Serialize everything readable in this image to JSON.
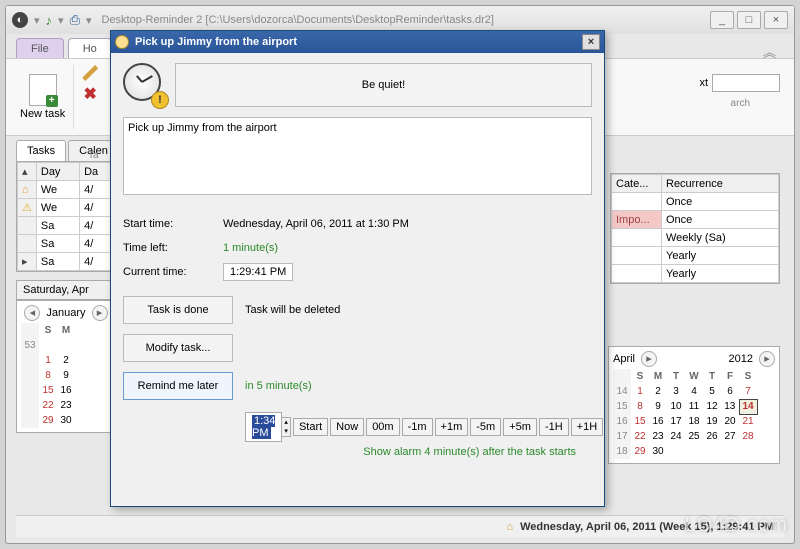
{
  "window": {
    "title": "Desktop-Reminder 2 [C:\\Users\\dozorca\\Documents\\DesktopReminder\\tasks.dr2]",
    "min": "_",
    "max": "□",
    "close": "×"
  },
  "menu": {
    "file": "File",
    "home_partial": "Ho"
  },
  "ribbon": {
    "new_task": "New task",
    "xt_label": "xt",
    "search_label": "arch",
    "tasks_footer": "Ta"
  },
  "tabs": {
    "tasks": "Tasks",
    "calendar": "Calen"
  },
  "table": {
    "cols": {
      "day": "Day",
      "date": "Da",
      "cate": "Cate...",
      "recur": "Recurrence"
    },
    "rows": [
      {
        "icon": "house",
        "day": "We",
        "date": "4/"
      },
      {
        "icon": "warn",
        "day": "We",
        "date": "4/"
      },
      {
        "icon": "",
        "day": "Sa",
        "date": "4/"
      },
      {
        "icon": "",
        "day": "Sa",
        "date": "4/"
      },
      {
        "icon": "",
        "day": "Sa",
        "date": "4/"
      }
    ],
    "right_rows": [
      {
        "cate": "",
        "recur": "Once"
      },
      {
        "cate": "Impo...",
        "recur": "Once"
      },
      {
        "cate": "",
        "recur": "Weekly (Sa)"
      },
      {
        "cate": "",
        "recur": "Yearly"
      },
      {
        "cate": "",
        "recur": "Yearly"
      }
    ]
  },
  "cal_left": {
    "header": "Saturday, Apr",
    "month": "January",
    "days": [
      "S",
      "M"
    ],
    "weeks": [
      {
        "wk": "53",
        "c": [
          "",
          ""
        ]
      },
      {
        "wk": "",
        "c": [
          "1",
          "2"
        ]
      },
      {
        "wk": "",
        "c": [
          "8",
          "9"
        ]
      },
      {
        "wk": "",
        "c": [
          "15",
          "16"
        ]
      },
      {
        "wk": "",
        "c": [
          "22",
          "23"
        ]
      },
      {
        "wk": "",
        "c": [
          "29",
          "30"
        ]
      }
    ]
  },
  "cal_right": {
    "month": "April",
    "year": "2012",
    "days": [
      "S",
      "M",
      "T",
      "W",
      "T",
      "F",
      "S"
    ],
    "weeks": [
      {
        "wk": "14",
        "c": [
          "1",
          "2",
          "3",
          "4",
          "5",
          "6",
          "7"
        ]
      },
      {
        "wk": "15",
        "c": [
          "8",
          "9",
          "10",
          "11",
          "12",
          "13",
          "14"
        ]
      },
      {
        "wk": "16",
        "c": [
          "15",
          "16",
          "17",
          "18",
          "19",
          "20",
          "21"
        ]
      },
      {
        "wk": "17",
        "c": [
          "22",
          "23",
          "24",
          "25",
          "26",
          "27",
          "28"
        ]
      },
      {
        "wk": "18",
        "c": [
          "29",
          "30",
          "",
          "",
          "",
          "",
          ""
        ]
      }
    ]
  },
  "status": "Wednesday, April 06, 2011 (Week 15), 1:29:41 PM",
  "modal": {
    "title": "Pick up Jimmy from the airport",
    "be_quiet": "Be quiet!",
    "task_text": "Pick up Jimmy from the airport",
    "start_label": "Start time:",
    "start_value": "Wednesday, April 06, 2011 at 1:30 PM",
    "left_label": "Time left:",
    "left_value": "1 minute(s)",
    "cur_label": "Current time:",
    "cur_value": "1:29:41 PM",
    "done_btn": "Task is done",
    "done_note": "Task will be deleted",
    "modify_btn": "Modify task...",
    "remind_btn": "Remind me later",
    "remind_note": "in 5 minute(s)",
    "spinner": "1:34 PM",
    "steps": [
      "Start",
      "Now",
      "00m",
      "-1m",
      "+1m",
      "-5m",
      "+5m",
      "-1H",
      "+1H"
    ],
    "green_foot": "Show alarm 4 minute(s) after the task starts"
  },
  "watermark": "LO4D.com"
}
